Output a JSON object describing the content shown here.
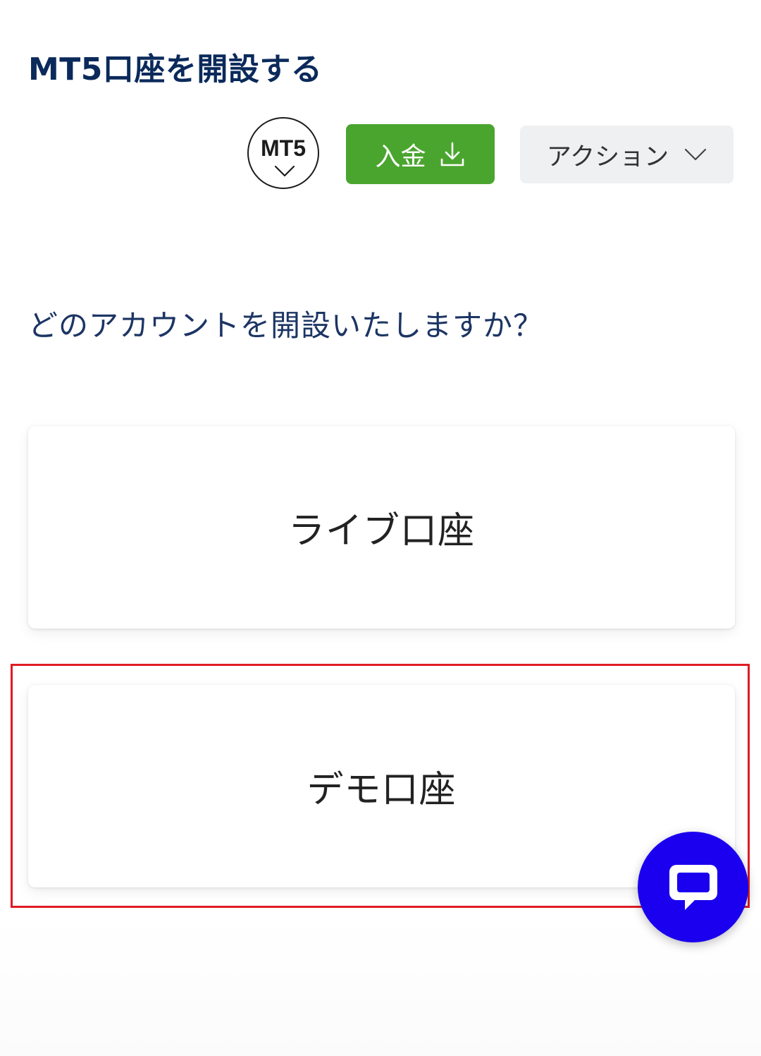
{
  "header": {
    "title": "MT5口座を開設する"
  },
  "toolbar": {
    "platform_badge": "MT5",
    "platform_badge_icon": "chevron-down-icon",
    "deposit_label": "入金",
    "deposit_icon": "download-icon",
    "deposit_color": "#4aa52e",
    "actions_label": "アクション",
    "actions_icon": "chevron-down-icon"
  },
  "main": {
    "question": "どのアカウントを開設いたしますか？",
    "options": [
      {
        "label": "ライブ口座"
      },
      {
        "label": "デモ口座",
        "highlighted": true
      }
    ],
    "highlight_color": "#e01b24"
  },
  "chat": {
    "icon": "chat-bubble-icon",
    "color": "#1a00ee"
  }
}
